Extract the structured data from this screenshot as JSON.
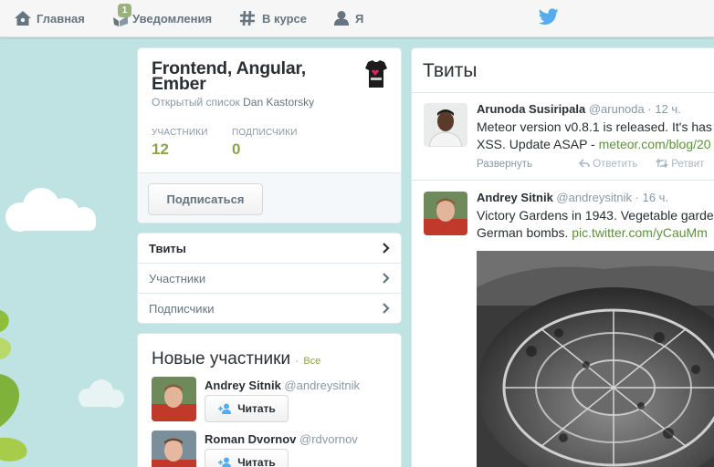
{
  "topnav": {
    "home": "Главная",
    "notifications": "Уведомления",
    "notifications_badge": "1",
    "discover": "В курсе",
    "me": "Я"
  },
  "list": {
    "title": "Frontend, Angular, Ember",
    "subtitle_prefix": "Открытый список",
    "owner": "Dan Kastorsky",
    "members_label": "УЧАСТНИКИ",
    "members_value": "12",
    "subscribers_label": "ПОДПИСЧИКИ",
    "subscribers_value": "0",
    "subscribe_button": "Подписаться"
  },
  "list_nav": [
    {
      "label": "Твиты"
    },
    {
      "label": "Участники"
    },
    {
      "label": "Подписчики"
    }
  ],
  "new_members": {
    "title": "Новые участники",
    "separator": "·",
    "all_link": "Все",
    "follow_label": "Читать",
    "items": [
      {
        "name": "Andrey Sitnik",
        "handle": "@andreysitnik"
      },
      {
        "name": "Roman Dvornov",
        "handle": "@rdvornov"
      }
    ]
  },
  "tweets": {
    "header": "Твиты",
    "items": [
      {
        "name": "Arunoda Susiripala",
        "handle": "@arunoda",
        "time": "12 ч.",
        "line1": "Meteor version v0.8.1 is released. It's has",
        "line2_text": "XSS. Update ASAP - ",
        "line2_link": "meteor.com/blog/20",
        "expand": "Развернуть",
        "reply": "Ответить",
        "retweet": "Ретвит"
      },
      {
        "name": "Andrey Sitnik",
        "handle": "@andreysitnik",
        "time": "16 ч.",
        "line1": "Victory Gardens in 1943. Vegetable garde",
        "line2_text": "German bombs. ",
        "line2_link": "pic.twitter.com/yCauMm"
      }
    ]
  },
  "colors": {
    "accent": "#8aa34c",
    "link": "#5c913b",
    "background": "#bfe3e3",
    "bird": "#55acee"
  }
}
